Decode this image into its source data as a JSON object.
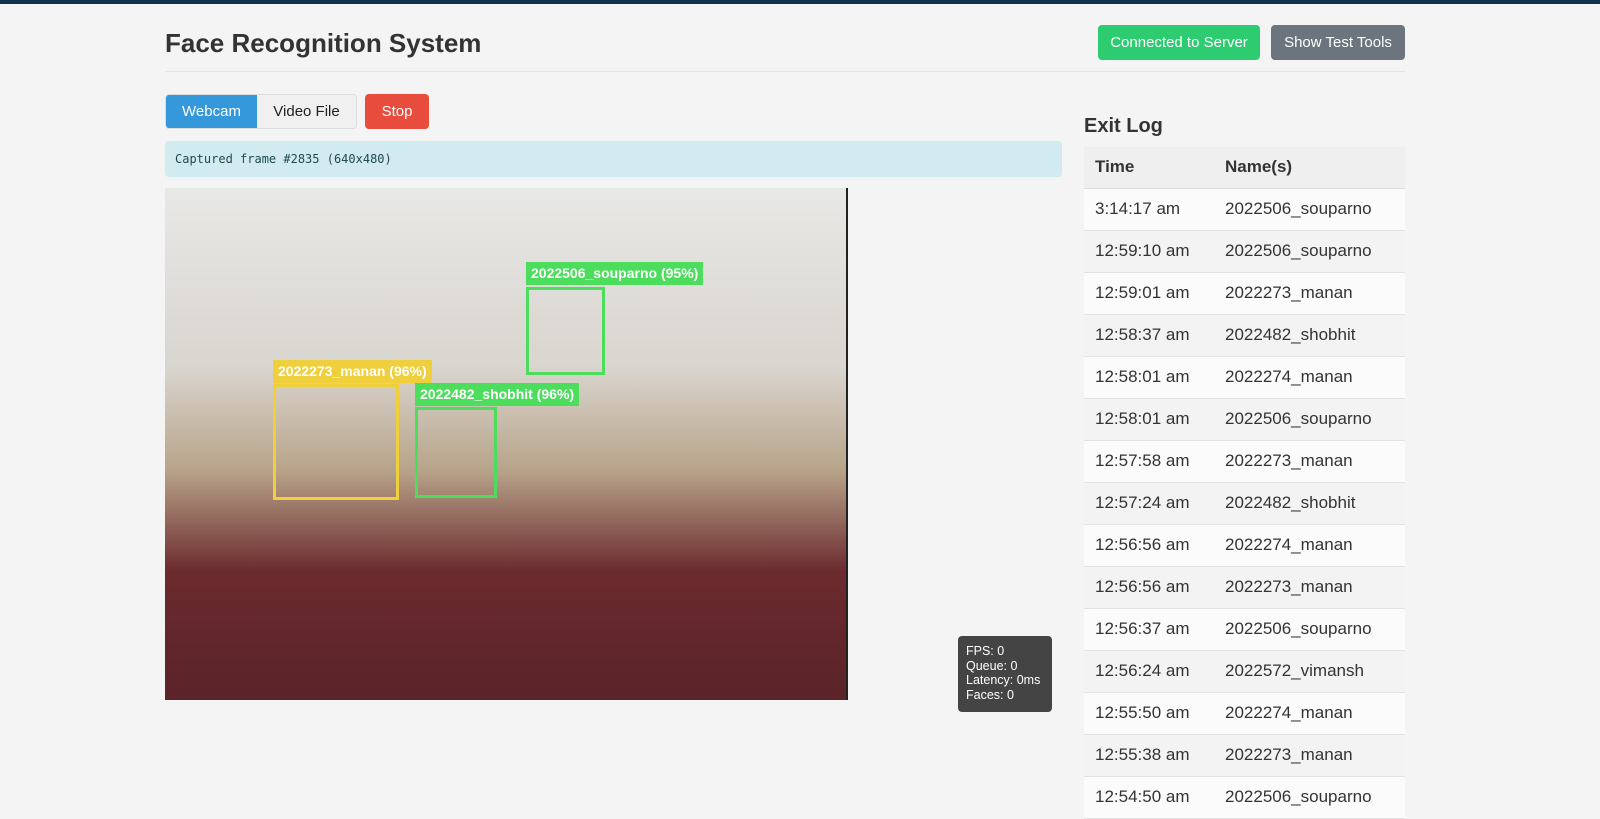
{
  "header": {
    "title": "Face Recognition System",
    "connected_label": "Connected to Server",
    "test_tools_label": "Show Test Tools"
  },
  "controls": {
    "webcam_label": "Webcam",
    "video_file_label": "Video File",
    "stop_label": "Stop",
    "active_source": "Webcam"
  },
  "status": "Captured frame #2835 (640x480)",
  "detections": [
    {
      "label": "2022506_souparno (95%)",
      "color": "#4cdd5c"
    },
    {
      "label": "2022273_manan (96%)",
      "color": "#f0cf3c"
    },
    {
      "label": "2022482_shobhit (96%)",
      "color": "#4cdd5c"
    }
  ],
  "stats": {
    "fps": "FPS: 0",
    "queue": "Queue: 0",
    "latency": "Latency: 0ms",
    "faces": "Faces: 0"
  },
  "exit_log": {
    "title": "Exit Log",
    "columns": [
      "Time",
      "Name(s)"
    ],
    "rows": [
      [
        "3:14:17 am",
        "2022506_souparno"
      ],
      [
        "12:59:10 am",
        "2022506_souparno"
      ],
      [
        "12:59:01 am",
        "2022273_manan"
      ],
      [
        "12:58:37 am",
        "2022482_shobhit"
      ],
      [
        "12:58:01 am",
        "2022274_manan"
      ],
      [
        "12:58:01 am",
        "2022506_souparno"
      ],
      [
        "12:57:58 am",
        "2022273_manan"
      ],
      [
        "12:57:24 am",
        "2022482_shobhit"
      ],
      [
        "12:56:56 am",
        "2022274_manan"
      ],
      [
        "12:56:56 am",
        "2022273_manan"
      ],
      [
        "12:56:37 am",
        "2022506_souparno"
      ],
      [
        "12:56:24 am",
        "2022572_vimansh"
      ],
      [
        "12:55:50 am",
        "2022274_manan"
      ],
      [
        "12:55:38 am",
        "2022273_manan"
      ],
      [
        "12:54:50 am",
        "2022506_souparno"
      ]
    ]
  }
}
